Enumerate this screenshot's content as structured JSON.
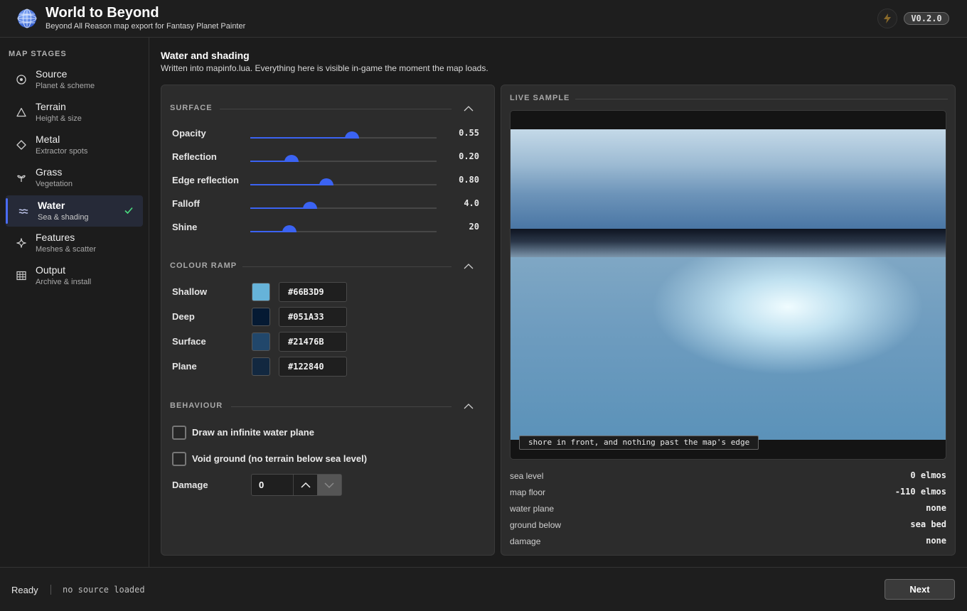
{
  "app": {
    "title": "World to Beyond",
    "subtitle": "Beyond All Reason map export for Fantasy Planet Painter",
    "version": "V0.2.0"
  },
  "sidebar": {
    "heading": "MAP STAGES",
    "items": [
      {
        "label": "Source",
        "sub": "Planet & scheme",
        "icon": "target-icon",
        "active": false
      },
      {
        "label": "Terrain",
        "sub": "Height & size",
        "icon": "triangle-icon",
        "active": false
      },
      {
        "label": "Metal",
        "sub": "Extractor spots",
        "icon": "diamond-icon",
        "active": false
      },
      {
        "label": "Grass",
        "sub": "Vegetation",
        "icon": "sprout-icon",
        "active": false
      },
      {
        "label": "Water",
        "sub": "Sea & shading",
        "icon": "waves-icon",
        "active": true,
        "completed": true
      },
      {
        "label": "Features",
        "sub": "Meshes & scatter",
        "icon": "sparkle-icon",
        "active": false
      },
      {
        "label": "Output",
        "sub": "Archive & install",
        "icon": "grid-icon",
        "active": false
      }
    ]
  },
  "page": {
    "title": "Water and shading",
    "description": "Written into mapinfo.lua. Everything here is visible in-game the moment the map loads."
  },
  "surface": {
    "heading": "SURFACE",
    "sliders": [
      {
        "label": "Opacity",
        "value": "0.55",
        "level": 0.545
      },
      {
        "label": "Reflection",
        "value": "0.20",
        "level": 0.22
      },
      {
        "label": "Edge reflection",
        "value": "0.80",
        "level": 0.41
      },
      {
        "label": "Falloff",
        "value": "4.0",
        "level": 0.32
      },
      {
        "label": "Shine",
        "value": "20",
        "level": 0.21
      }
    ]
  },
  "colour_ramp": {
    "heading": "COLOUR RAMP",
    "colors": [
      {
        "label": "Shallow",
        "hex": "#66B3D9",
        "swatch": "#66b3d9"
      },
      {
        "label": "Deep",
        "hex": "#051A33",
        "swatch": "#051a33"
      },
      {
        "label": "Surface",
        "hex": "#21476B",
        "swatch": "#21476b"
      },
      {
        "label": "Plane",
        "hex": "#122840",
        "swatch": "#122840"
      }
    ]
  },
  "behaviour": {
    "heading": "BEHAVIOUR",
    "infinite_plane": "Draw an infinite water plane",
    "void_ground": "Void ground (no terrain below sea level)",
    "damage_label": "Damage",
    "damage_value": "0"
  },
  "live_sample": {
    "heading": "LIVE SAMPLE",
    "caption": "shore in front, and nothing past the map's edge",
    "stats": [
      {
        "key": "sea level",
        "value": "0 elmos"
      },
      {
        "key": "map floor",
        "value": "-110 elmos"
      },
      {
        "key": "water plane",
        "value": "none"
      },
      {
        "key": "ground below",
        "value": "sea bed"
      },
      {
        "key": "damage",
        "value": "none"
      }
    ]
  },
  "status": {
    "state": "Ready",
    "detail": "no source loaded",
    "next_label": "Next"
  },
  "colors": {
    "accent": "#3b63f3",
    "check": "#4ade80",
    "bolt": "#e0a030"
  }
}
